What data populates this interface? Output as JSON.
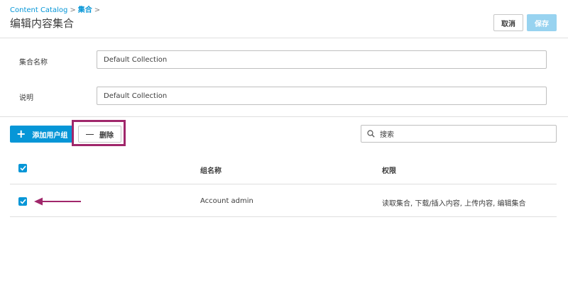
{
  "breadcrumb": {
    "root": "Content Catalog",
    "separator": ">",
    "current": "集合",
    "trailing": ">"
  },
  "page_title": "编辑内容集合",
  "header_buttons": {
    "cancel": "取消",
    "save": "保存"
  },
  "form": {
    "name_label": "集合名称",
    "name_value": "Default Collection",
    "description_label": "说明",
    "description_value": "Default Collection"
  },
  "toolbar": {
    "add_label": "添加用户组",
    "delete_label": "删除",
    "search_placeholder": "搜索"
  },
  "table": {
    "columns": {
      "group_name": "组名称",
      "permissions": "权限"
    },
    "rows": [
      {
        "checked": true,
        "group_name": "Account admin",
        "permissions": "读取集合, 下载/插入内容, 上传内容, 编辑集合"
      }
    ]
  },
  "colors": {
    "accent": "#0696d7",
    "accent_disabled": "#98d3f0",
    "annotation": "#a0276b"
  },
  "icons": [
    "plus-icon",
    "minus-icon",
    "search-icon",
    "checkmark-icon",
    "arrow-left-icon"
  ]
}
